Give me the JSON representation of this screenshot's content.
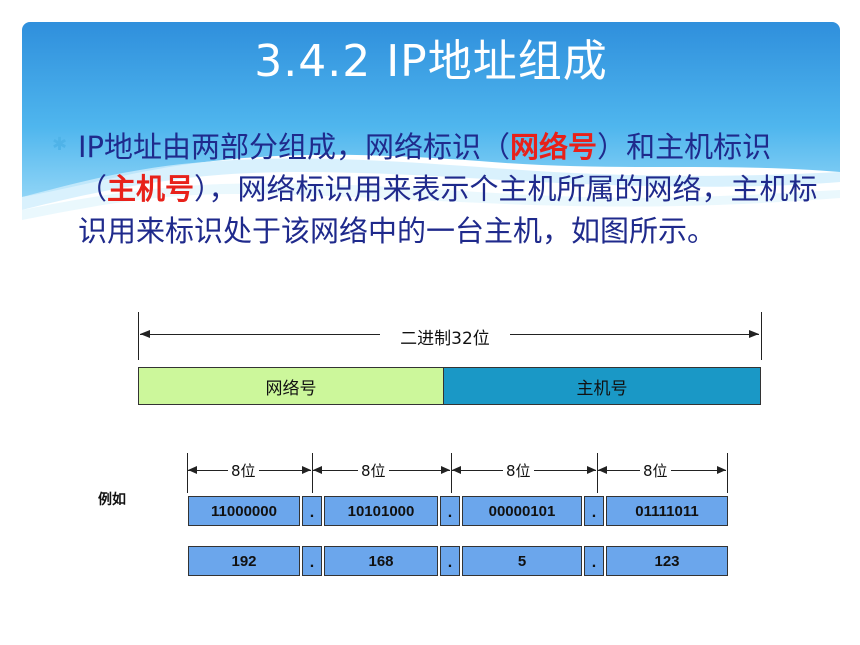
{
  "slide": {
    "title": "3.4.2  IP地址组成",
    "paragraph": {
      "part1": "IP地址由两部分组成，网络标识（",
      "highlight1": "网络号",
      "part2": "）和主机标识（",
      "highlight2": "主机号",
      "part3": "），网络标识用来表示个主机所属的网络，主机标识用来标识处于该网络中的一台主机，如图所示。"
    }
  },
  "diagram": {
    "total_bits_label": "二进制32位",
    "network_label": "网络号",
    "host_label": "主机号",
    "octet_bits_label": "8位",
    "example_label": "例如",
    "binary_row": [
      "11000000",
      "10101000",
      "00000101",
      "01111011"
    ],
    "decimal_row": [
      "192",
      "168",
      "5",
      "123"
    ],
    "separator": "."
  },
  "colors": {
    "header_blue": "#2a8fd8",
    "text_blue": "#1f2a8c",
    "highlight_red": "#e8211a",
    "network_green": "#ccf79b",
    "host_teal": "#1a98c6",
    "cell_blue": "#6ba6ec"
  }
}
